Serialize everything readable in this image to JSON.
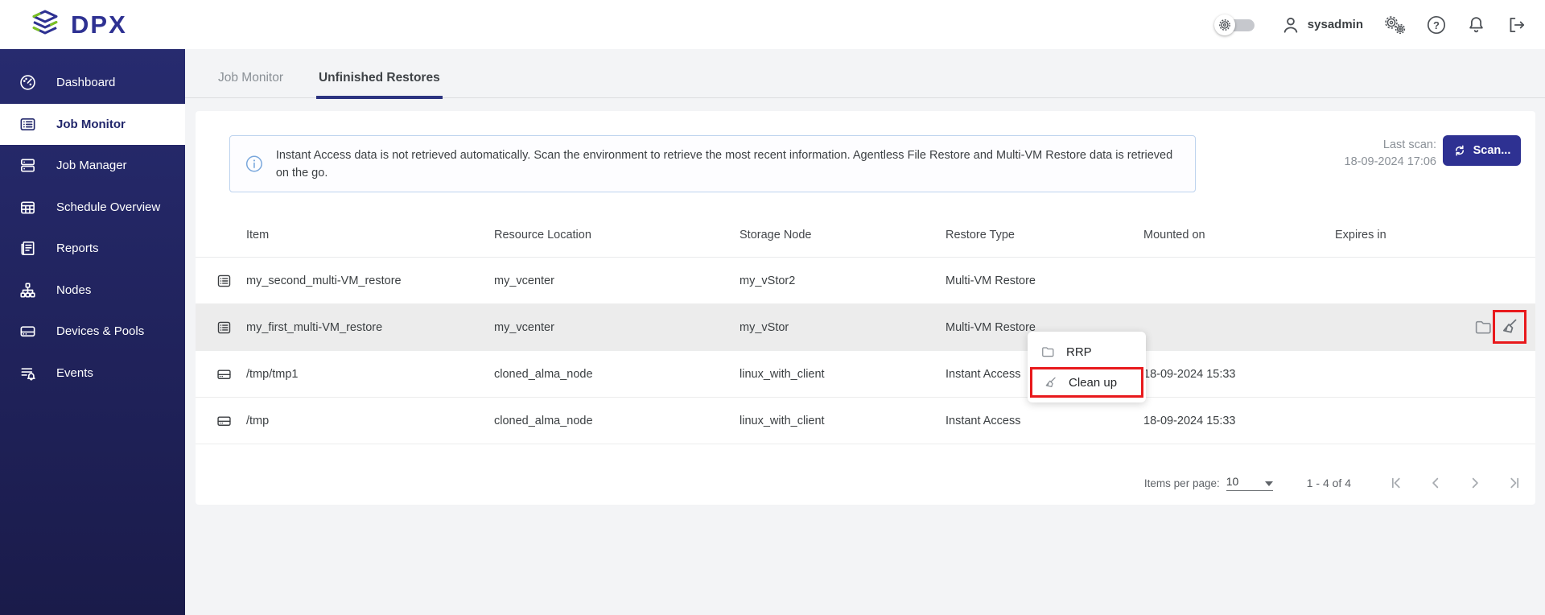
{
  "brand": {
    "name": "DPX",
    "color_navy": "#2e3192",
    "color_green": "#7ac122"
  },
  "topbar": {
    "username": "sysadmin",
    "icons": [
      "theme-toggle-gear",
      "user-icon",
      "settings-gears-icon",
      "help-icon",
      "notifications-bell-icon",
      "logout-icon"
    ]
  },
  "sidebar": {
    "items": [
      {
        "label": "Dashboard",
        "icon": "gauge-icon",
        "active": false
      },
      {
        "label": "Job Monitor",
        "icon": "list-icon",
        "active": true
      },
      {
        "label": "Job Manager",
        "icon": "cards-icon",
        "active": false
      },
      {
        "label": "Schedule Overview",
        "icon": "calendar-icon",
        "active": false
      },
      {
        "label": "Reports",
        "icon": "report-icon",
        "active": false
      },
      {
        "label": "Nodes",
        "icon": "nodes-icon",
        "active": false
      },
      {
        "label": "Devices & Pools",
        "icon": "drive-icon",
        "active": false
      },
      {
        "label": "Events",
        "icon": "event-list-bell-icon",
        "active": false
      }
    ]
  },
  "tabs": [
    {
      "label": "Job Monitor",
      "active": false
    },
    {
      "label": "Unfinished Restores",
      "active": true
    }
  ],
  "banner": {
    "icon": "info-icon",
    "text": "Instant Access data is not retrieved automatically. Scan the environment to retrieve the most recent information. Agentless File Restore and Multi-VM Restore data is retrieved on the go."
  },
  "scan": {
    "last_scan_label": "Last scan:",
    "last_scan_value": "18-09-2024 17:06",
    "button_label": "Scan...",
    "button_icon": "refresh-icon",
    "button_color": "#2e3192"
  },
  "table": {
    "columns": [
      "Item",
      "Resource Location",
      "Storage Node",
      "Restore Type",
      "Mounted on",
      "Expires in"
    ],
    "rows": [
      {
        "icon": "multi-vm-list-icon",
        "item": "my_second_multi-VM_restore",
        "resource_location": "my_vcenter",
        "storage_node": "my_vStor2",
        "restore_type": "Multi-VM Restore",
        "mounted_on": "",
        "expires_in": "",
        "highlighted": false
      },
      {
        "icon": "multi-vm-list-icon",
        "item": "my_first_multi-VM_restore",
        "resource_location": "my_vcenter",
        "storage_node": "my_vStor",
        "restore_type": "Multi-VM Restore",
        "mounted_on": "",
        "expires_in": "",
        "highlighted": true,
        "actions": [
          "folder-icon",
          "broom-icon"
        ]
      },
      {
        "icon": "hard-drive-icon",
        "item": "/tmp/tmp1",
        "resource_location": "cloned_alma_node",
        "storage_node": "linux_with_client",
        "restore_type": "Instant Access",
        "mounted_on": "18-09-2024 15:33",
        "expires_in": "",
        "highlighted": false
      },
      {
        "icon": "hard-drive-icon",
        "item": "/tmp",
        "resource_location": "cloned_alma_node",
        "storage_node": "linux_with_client",
        "restore_type": "Instant Access",
        "mounted_on": "18-09-2024 15:33",
        "expires_in": "",
        "highlighted": false
      }
    ]
  },
  "context_menu": {
    "items": [
      {
        "label": "RRP",
        "icon": "folder-icon",
        "annotated": false
      },
      {
        "label": "Clean up",
        "icon": "broom-icon",
        "annotated": true
      }
    ]
  },
  "pagination": {
    "items_per_page_label": "Items per page:",
    "items_per_page_value": "10",
    "range_label": "1 - 4 of 4",
    "nav_icons": [
      "first-page-icon",
      "prev-page-icon",
      "next-page-icon",
      "last-page-icon"
    ]
  },
  "annotation": {
    "color": "#e8191c"
  }
}
